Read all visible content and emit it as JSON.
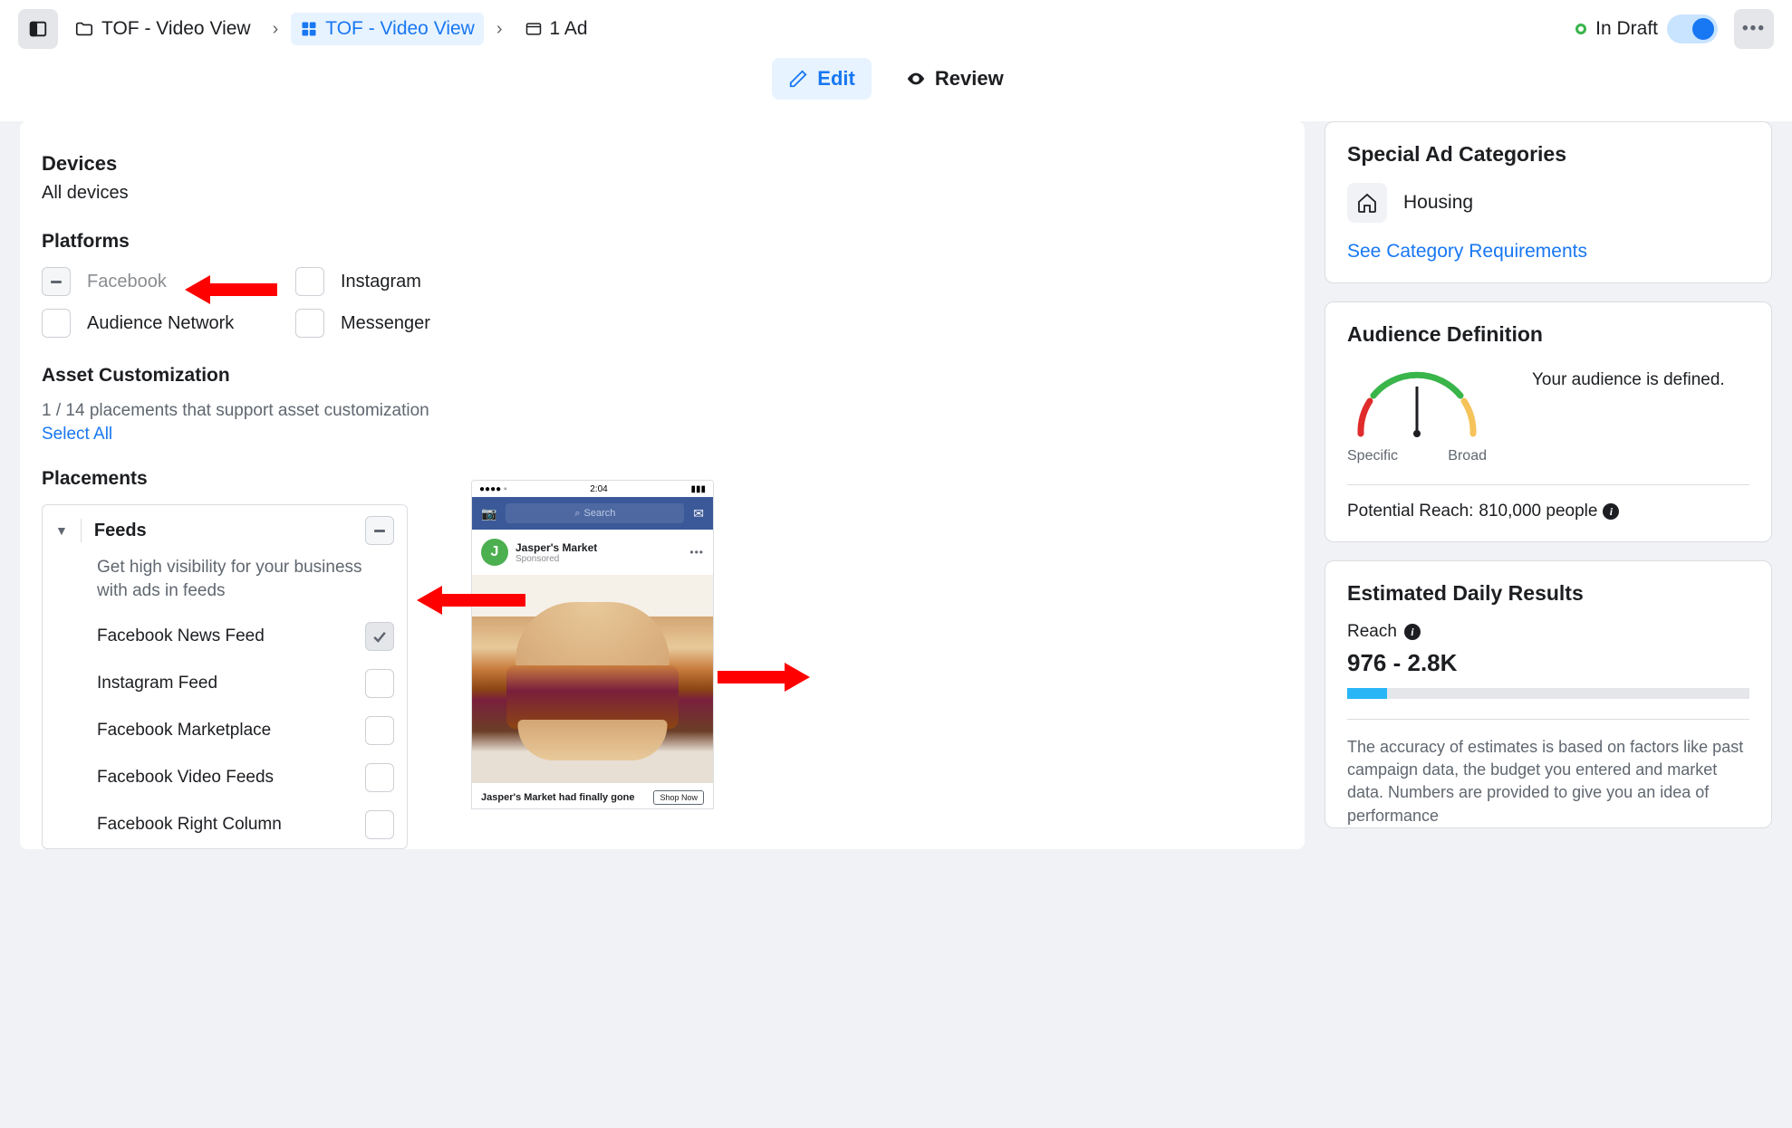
{
  "header": {
    "breadcrumbs": {
      "campaign": "TOF - Video View",
      "adset": "TOF - Video View",
      "ad": "1 Ad"
    },
    "status": "In Draft",
    "tabs": {
      "edit": "Edit",
      "review": "Review"
    }
  },
  "main": {
    "devices": {
      "title": "Devices",
      "value": "All devices"
    },
    "platforms": {
      "title": "Platforms",
      "items": {
        "facebook": "Facebook",
        "instagram": "Instagram",
        "audience_network": "Audience Network",
        "messenger": "Messenger"
      }
    },
    "asset": {
      "title": "Asset Customization",
      "desc": "1 / 14 placements that support asset customization",
      "link": "Select All"
    },
    "placements": {
      "title": "Placements",
      "feeds": {
        "title": "Feeds",
        "desc": "Get high visibility for your business with ads in feeds",
        "items": [
          "Facebook News Feed",
          "Instagram Feed",
          "Facebook Marketplace",
          "Facebook Video Feeds",
          "Facebook Right Column"
        ]
      }
    },
    "preview": {
      "time": "2:04",
      "search": "Search",
      "page_name": "Jasper's Market",
      "sponsored": "Sponsored",
      "headline": "Jasper's Market had finally gone",
      "cta": "Shop Now"
    }
  },
  "sidebar": {
    "special": {
      "title": "Special Ad Categories",
      "category": "Housing",
      "link": "See Category Requirements"
    },
    "audience": {
      "title": "Audience Definition",
      "status": "Your audience is defined.",
      "specific": "Specific",
      "broad": "Broad",
      "reach_label": "Potential Reach:",
      "reach_value": "810,000 people"
    },
    "results": {
      "title": "Estimated Daily Results",
      "reach_label": "Reach",
      "reach_value": "976 - 2.8K",
      "disclaimer": "The accuracy of estimates is based on factors like past campaign data, the budget you entered and market data. Numbers are provided to give you an idea of performance"
    }
  }
}
